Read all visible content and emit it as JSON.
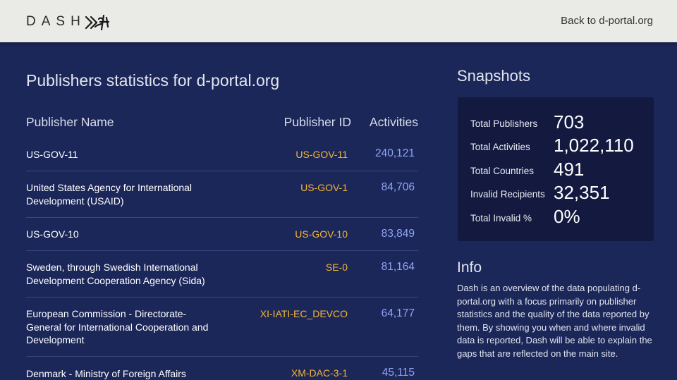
{
  "header": {
    "brand_text": "DASH",
    "back_link": "Back to d-portal.org"
  },
  "main": {
    "title": "Publishers statistics for d-portal.org",
    "columns": {
      "name": "Publisher Name",
      "id": "Publisher ID",
      "activities": "Activities"
    },
    "rows": [
      {
        "name": "US-GOV-11",
        "id": "US-GOV-11",
        "activities": "240,121"
      },
      {
        "name": "United States Agency for International Development (USAID)",
        "id": "US-GOV-1",
        "activities": "84,706"
      },
      {
        "name": "US-GOV-10",
        "id": "US-GOV-10",
        "activities": "83,849"
      },
      {
        "name": "Sweden, through Swedish International Development Cooperation Agency (Sida)",
        "id": "SE-0",
        "activities": "81,164"
      },
      {
        "name": "European Commission - Directorate-General for International Cooperation and Development",
        "id": "XI-IATI-EC_DEVCO",
        "activities": "64,177"
      },
      {
        "name": "Denmark - Ministry of Foreign Affairs",
        "id": "XM-DAC-3-1",
        "activities": "45,115"
      }
    ]
  },
  "snapshots": {
    "title": "Snapshots",
    "stats": [
      {
        "label": "Total Publishers",
        "value": "703"
      },
      {
        "label": "Total Activities",
        "value": "1,022,110"
      },
      {
        "label": "Total Countries",
        "value": "491"
      },
      {
        "label": "Invalid Recipients",
        "value": "32,351"
      },
      {
        "label": "Total Invalid %",
        "value": "0%"
      }
    ]
  },
  "info": {
    "title": "Info",
    "text": "Dash is an overview of the data populating d-portal.org with a focus primarily on publisher statistics and the quality of the data reported by them. By showing you when and where invalid data is reported, Dash will be able to explain the gaps that are reflected on the main site."
  },
  "colors": {
    "background": "#1c2759",
    "topbar": "#eaeae7",
    "publisher_id": "#f3b633",
    "activities": "#8ea4f5",
    "snapshot_box": "#141a3f"
  }
}
